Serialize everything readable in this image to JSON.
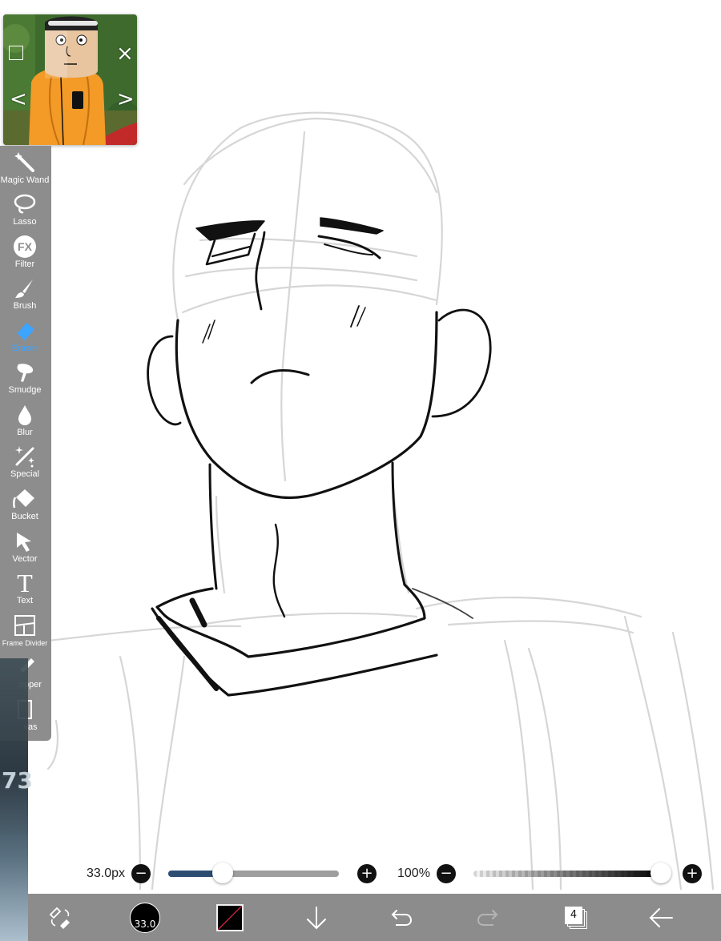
{
  "reference_window": {
    "icons": {
      "frame": "square-outline-icon",
      "close": "close-icon",
      "prev": "chevron-left-icon",
      "next": "chevron-right-icon"
    },
    "glyphs": {
      "close": "×",
      "prev": "<",
      "next": ">"
    }
  },
  "toolbar": {
    "items": [
      {
        "label": "Magic Wand",
        "icon": "magic-wand-icon",
        "active": false
      },
      {
        "label": "Lasso",
        "icon": "lasso-icon",
        "active": false
      },
      {
        "label": "Filter",
        "icon": "fx-filter-icon",
        "active": false,
        "glyph": "FX"
      },
      {
        "label": "Brush",
        "icon": "brush-icon",
        "active": false
      },
      {
        "label": "Eraser",
        "icon": "eraser-icon",
        "active": true
      },
      {
        "label": "Smudge",
        "icon": "smudge-icon",
        "active": false
      },
      {
        "label": "Blur",
        "icon": "blur-drop-icon",
        "active": false
      },
      {
        "label": "Special",
        "icon": "special-sparkle-icon",
        "active": false
      },
      {
        "label": "Bucket",
        "icon": "bucket-icon",
        "active": false
      },
      {
        "label": "Vector",
        "icon": "vector-arrow-icon",
        "active": false
      },
      {
        "label": "Text",
        "icon": "text-icon",
        "active": false,
        "glyph": "T"
      },
      {
        "label": "Frame Divider",
        "icon": "frame-divider-icon",
        "active": false
      },
      {
        "label": "opper",
        "icon": "eyedropper-icon",
        "active": false
      },
      {
        "label": "vas",
        "icon": "canvas-icon",
        "active": false
      }
    ],
    "active_color": "#3da4ff"
  },
  "brush_controls": {
    "size_label": "33.0px",
    "size_slider_level": 0.32,
    "opacity_label": "100%",
    "opacity_slider_level": 1.0,
    "minus_glyph": "−",
    "plus_glyph": "+",
    "fill_color": "#2d4d73"
  },
  "bottom_bar": {
    "tool_swap_icon": "brush-eraser-swap-icon",
    "brush_size_text": "33.0",
    "color_swatch": "#000000",
    "download_icon": "arrow-down-icon",
    "undo_icon": "undo-icon",
    "redo_icon": "redo-icon",
    "layer_count": "4",
    "layers_icon": "layers-icon",
    "back_icon": "arrow-left-icon"
  },
  "edge_app": {
    "text": "73"
  }
}
